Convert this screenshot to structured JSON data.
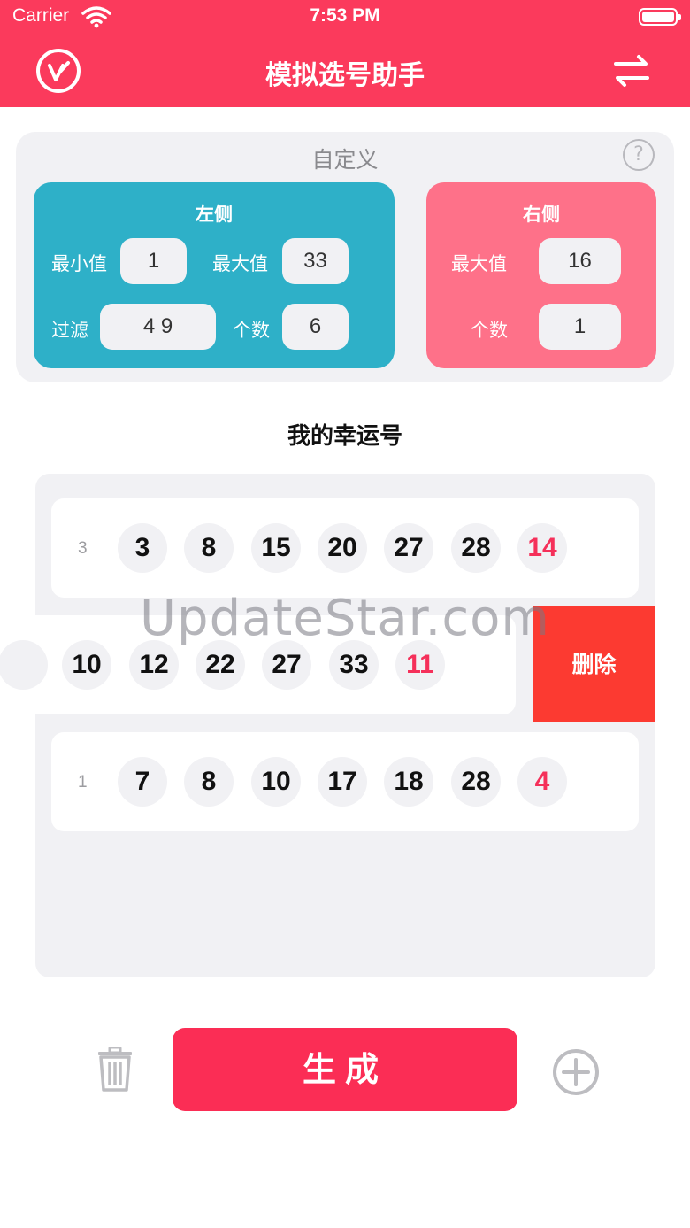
{
  "status_bar": {
    "carrier": "Carrier",
    "time": "7:53 PM"
  },
  "nav": {
    "title": "模拟选号助手"
  },
  "custom": {
    "title": "自定义",
    "help": "?",
    "left": {
      "title": "左侧",
      "min_label": "最小值",
      "min_value": "1",
      "max_label": "最大值",
      "max_value": "33",
      "filter_label": "过滤",
      "filter_value": "4 9",
      "count_label": "个数",
      "count_value": "6"
    },
    "right": {
      "title": "右侧",
      "max_label": "最大值",
      "max_value": "16",
      "count_label": "个数",
      "count_value": "1"
    }
  },
  "lucky": {
    "title": "我的幸运号",
    "rows": [
      {
        "index": "3",
        "numbers": [
          "3",
          "8",
          "15",
          "20",
          "27",
          "28"
        ],
        "special": "14"
      },
      {
        "index": "",
        "numbers": [
          "10",
          "12",
          "22",
          "27",
          "33"
        ],
        "special": "11"
      },
      {
        "index": "1",
        "numbers": [
          "7",
          "8",
          "10",
          "17",
          "18",
          "28"
        ],
        "special": "4"
      }
    ],
    "delete_label": "删除"
  },
  "watermark": "UpdateStar.com",
  "actions": {
    "generate_label": "生成"
  },
  "colors": {
    "header": "#fb3a5c",
    "left_panel": "#2eb0c8",
    "right_panel": "#fe7189",
    "special_ball": "#f5305a",
    "delete": "#fc3a31"
  }
}
